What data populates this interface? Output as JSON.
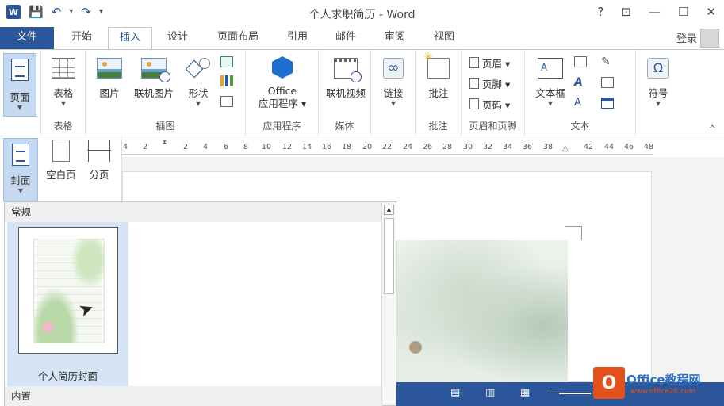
{
  "window": {
    "title": "个人求职简历 - Word",
    "app_logo": "W",
    "controls": {
      "help": "?",
      "ribbon_display": "⊡",
      "minimize": "—",
      "maximize": "☐",
      "close": "✕"
    }
  },
  "qat": {
    "save": "💾",
    "undo": "↶",
    "undo_more": "▾",
    "redo": "↷",
    "customize": "▾"
  },
  "tabs": [
    {
      "label": "文件"
    },
    {
      "label": "开始"
    },
    {
      "label": "插入"
    },
    {
      "label": "设计"
    },
    {
      "label": "页面布局"
    },
    {
      "label": "引用"
    },
    {
      "label": "邮件"
    },
    {
      "label": "审阅"
    },
    {
      "label": "视图"
    }
  ],
  "account": {
    "login": "登录"
  },
  "ribbon": {
    "groups": {
      "pages": {
        "label": "",
        "page_btn": "页面"
      },
      "tables": {
        "label": "表格",
        "table_btn": "表格"
      },
      "illustrations": {
        "label": "插图",
        "picture": "图片",
        "online_picture": "联机图片",
        "shapes": "形状"
      },
      "apps": {
        "label": "应用程序",
        "office_line1": "Office",
        "office_line2": "应用程序 ▾"
      },
      "media": {
        "label": "媒体",
        "online_video": "联机视频"
      },
      "links": {
        "label": "",
        "link": "链接"
      },
      "comments": {
        "label": "批注",
        "comment": "批注"
      },
      "header_footer": {
        "label": "页眉和页脚",
        "header": "页眉 ▾",
        "footer": "页脚 ▾",
        "page_number": "页码 ▾"
      },
      "text": {
        "label": "文本",
        "textbox": "文本框"
      },
      "symbols": {
        "label": "",
        "symbol": "符号",
        "symbol_glyph": "Ω"
      }
    },
    "collapse": "^"
  },
  "pages_dropdown": {
    "cover": "封面",
    "blank": "空白页",
    "break": "分页"
  },
  "ruler": [
    "4",
    "2",
    "2",
    "4",
    "6",
    "8",
    "10",
    "12",
    "14",
    "16",
    "18",
    "20",
    "22",
    "24",
    "26",
    "28",
    "30",
    "32",
    "34",
    "36",
    "38",
    "42",
    "44",
    "46",
    "48"
  ],
  "gallery": {
    "section1": "常规",
    "item_label": "个人简历封面",
    "section2": "内置"
  },
  "statusbar": {
    "view1": "▤",
    "view2": "▥",
    "view3": "▦",
    "zoom_minus": "—"
  },
  "watermark": {
    "logo_letter": "O",
    "name": "Office教程网",
    "url": "www.office26.com"
  },
  "colors": {
    "accent": "#2b579a",
    "gallery_highlight": "#d6e5f5",
    "watermark": "#e3501a"
  }
}
